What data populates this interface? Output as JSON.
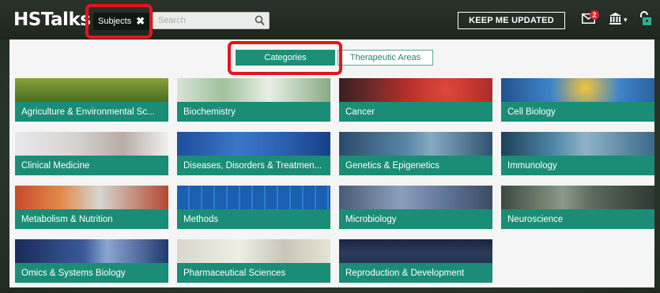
{
  "header": {
    "logo": "HSTalks",
    "subjects_label": "Subjects",
    "subjects_close": "✖",
    "search_placeholder": "Search",
    "keep_updated": "KEEP ME UPDATED",
    "mail_badge": "2"
  },
  "tabs": [
    {
      "label": "Categories",
      "active": true
    },
    {
      "label": "Therapeutic Areas",
      "active": false
    }
  ],
  "categories": [
    {
      "label": "Agriculture & Environmental Sc..."
    },
    {
      "label": "Biochemistry"
    },
    {
      "label": "Cancer"
    },
    {
      "label": "Cell Biology"
    },
    {
      "label": "Clinical Medicine"
    },
    {
      "label": "Diseases, Disorders & Treatmen..."
    },
    {
      "label": "Genetics & Epigenetics"
    },
    {
      "label": "Immunology"
    },
    {
      "label": "Metabolism & Nutrition"
    },
    {
      "label": "Methods"
    },
    {
      "label": "Microbiology"
    },
    {
      "label": "Neuroscience"
    },
    {
      "label": "Omics & Systems Biology"
    },
    {
      "label": "Pharmaceutical Sciences"
    },
    {
      "label": "Reproduction & Development"
    }
  ],
  "colors": {
    "accent": "#1a8d76",
    "highlight": "#e0161f",
    "header_bg": "#1e261e"
  }
}
